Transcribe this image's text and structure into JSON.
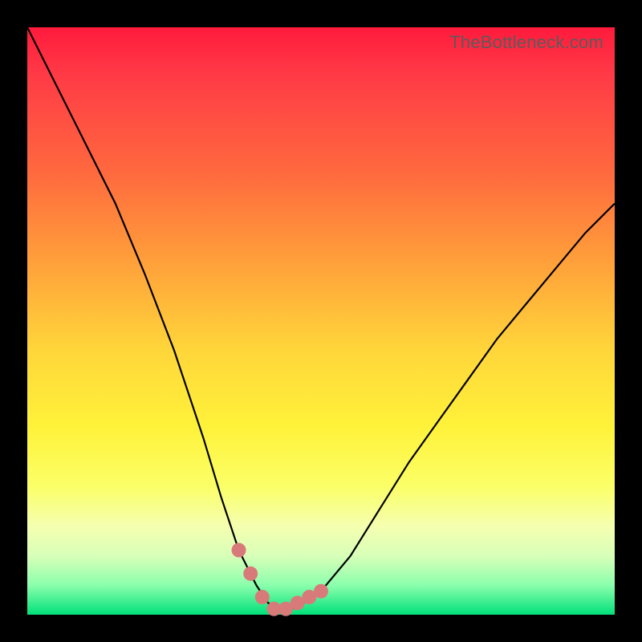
{
  "watermark": "TheBottleneck.com",
  "colors": {
    "background": "#000000",
    "curve_stroke": "#000000",
    "marker_fill": "#d97a7a",
    "gradient_top": "#ff1a3c",
    "gradient_mid": "#fff23a",
    "gradient_bottom": "#00e07a"
  },
  "chart_data": {
    "type": "line",
    "title": "",
    "xlabel": "",
    "ylabel": "",
    "xlim": [
      0,
      100
    ],
    "ylim": [
      0,
      100
    ],
    "series": [
      {
        "name": "bottleneck-curve",
        "x": [
          0,
          5,
          10,
          15,
          20,
          25,
          30,
          33,
          36,
          39,
          41,
          43,
          45,
          47,
          50,
          55,
          60,
          65,
          70,
          75,
          80,
          85,
          90,
          95,
          100
        ],
        "values": [
          100,
          90,
          80,
          70,
          58,
          45,
          30,
          20,
          11,
          5,
          2,
          1,
          1,
          2,
          4,
          10,
          18,
          26,
          33,
          40,
          47,
          53,
          59,
          65,
          70
        ]
      }
    ],
    "markers": {
      "name": "highlighted-points",
      "x": [
        36,
        38,
        40,
        42,
        44,
        46,
        48,
        50
      ],
      "values": [
        11,
        7,
        3,
        1,
        1,
        2,
        3,
        4
      ]
    }
  }
}
